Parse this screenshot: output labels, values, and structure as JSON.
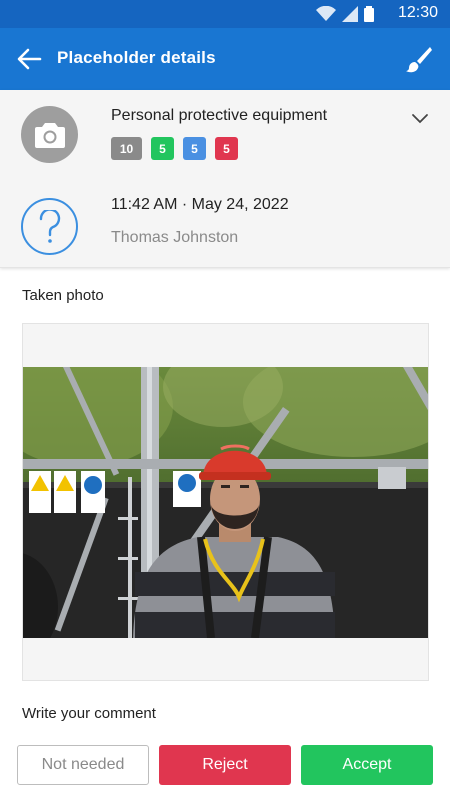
{
  "status_bar": {
    "time": "12:30",
    "icons": [
      "wifi-icon",
      "signal-icon",
      "battery-icon"
    ]
  },
  "app_bar": {
    "title": "Placeholder details",
    "back_icon": "arrow-left-icon",
    "action_icon": "brush-icon"
  },
  "item": {
    "category": "Personal protective equipment",
    "badges": [
      {
        "value": "10",
        "color": "#8a8a8a"
      },
      {
        "value": "5",
        "color": "#22c55e"
      },
      {
        "value": "5",
        "color": "#4a90e2"
      },
      {
        "value": "5",
        "color": "#e0364f"
      }
    ],
    "timestamp": "11:42 AM · May 24, 2022",
    "author": "Thomas Johnston"
  },
  "photo_section": {
    "label": "Taken photo"
  },
  "comment_section": {
    "label": "Write your comment"
  },
  "actions": {
    "not_needed": "Not needed",
    "reject": "Reject",
    "accept": "Accept"
  },
  "colors": {
    "primary": "#1976d2",
    "status_bar": "#1565c0",
    "reject": "#e0364f",
    "accept": "#22c55e"
  }
}
